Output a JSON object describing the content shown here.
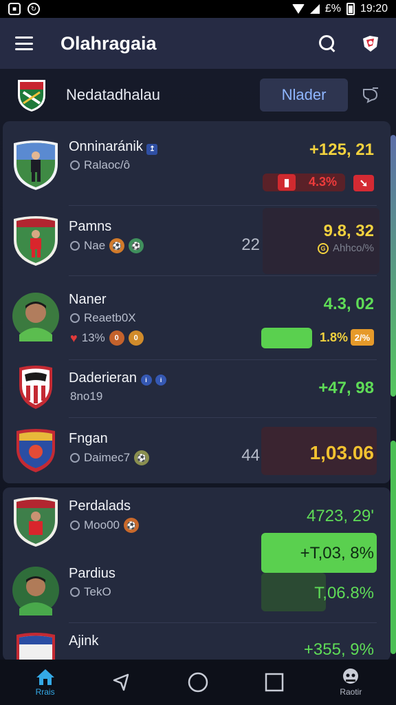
{
  "status_bar": {
    "battery_text": "£%",
    "time": "19:20"
  },
  "header": {
    "title": "Olahragaia"
  },
  "subheader": {
    "league_name": "Nedatadhalau",
    "filter_label": "Nlader"
  },
  "players": [
    {
      "name": "Onninaránik",
      "sub": "Ralaoc/ô",
      "value": "+125, 21",
      "value_color": "yellow",
      "tag_text": "4.3%",
      "tag_color": "red"
    },
    {
      "name": "Pamns",
      "sub": "Nae",
      "count": "22",
      "value": "9.8, 32",
      "secondary": "Ahhco/%"
    },
    {
      "name": "Naner",
      "sub": "Reaetb0X",
      "extra": "13%",
      "value": "4.3, 02",
      "bar_percent": 0.44,
      "tag_text": "1.8%",
      "tag2_text": "2/%"
    },
    {
      "name": "Daderieran",
      "sub": "8no19",
      "value": "+47, 98"
    },
    {
      "name": "Fngan",
      "sub": "Daimec7",
      "count": "44",
      "value": "1,03.06"
    },
    {
      "name": "Perdalads",
      "sub": "Moo00",
      "value": "4723, 29'",
      "highlight": "+T,03, 8%"
    },
    {
      "name": "Pardius",
      "sub": "TekO",
      "value": "T,06.8%"
    },
    {
      "name": "Ajink",
      "value": "+355, 9%"
    }
  ],
  "bottom_nav": [
    {
      "label": "Rrais",
      "icon": "home-icon",
      "active": true
    },
    {
      "label": "",
      "icon": "back-icon"
    },
    {
      "label": "",
      "icon": "circle-home-icon"
    },
    {
      "label": "",
      "icon": "square-recent-icon"
    },
    {
      "label": "Raotir",
      "icon": "profile-icon"
    }
  ],
  "colors": {
    "accent": "#34a9e6",
    "positive": "#5fdc57",
    "negative": "#ef3b3b",
    "highlight": "#f3d23e"
  }
}
